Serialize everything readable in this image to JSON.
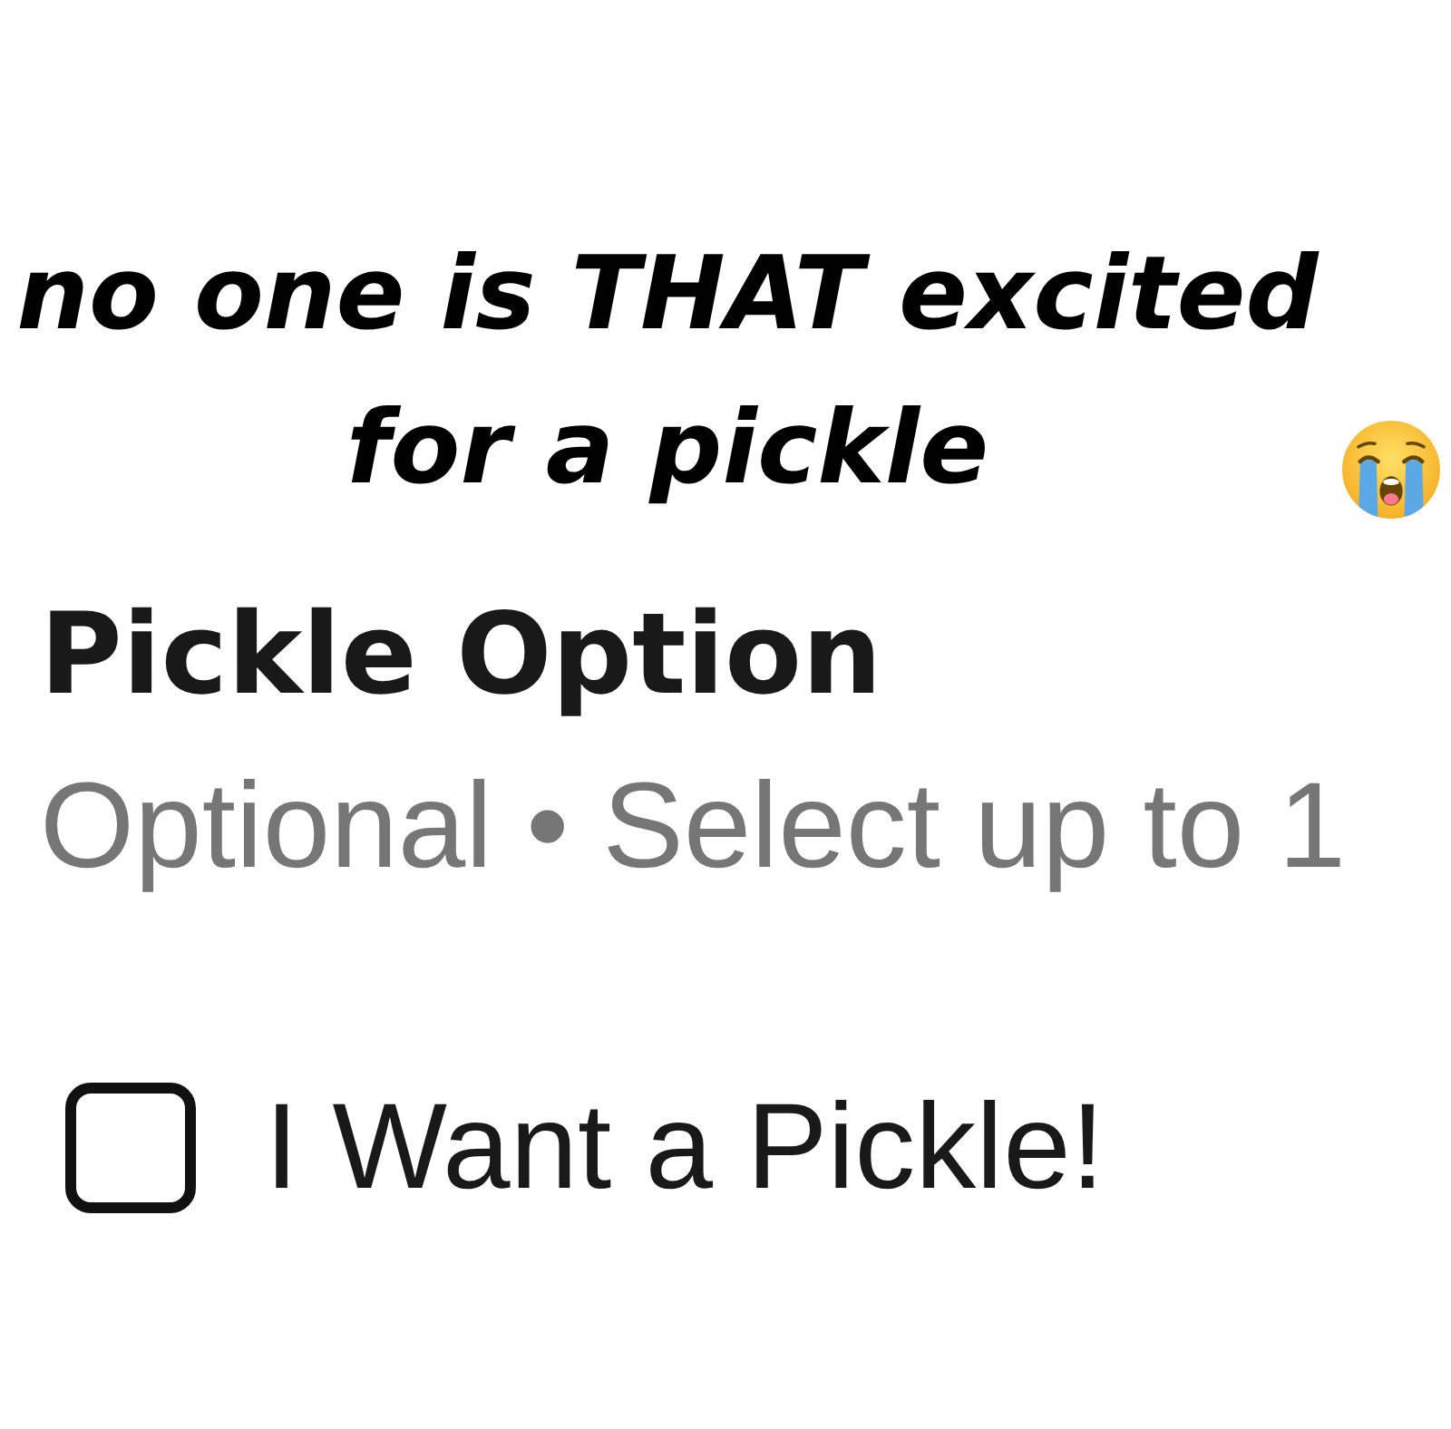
{
  "caption": "no one is THAT excited for a pickle",
  "section": {
    "title": "Pickle Option",
    "subtitle": "Optional • Select up to 1",
    "options": [
      {
        "label": "I Want a Pickle!",
        "checked": false
      }
    ]
  }
}
